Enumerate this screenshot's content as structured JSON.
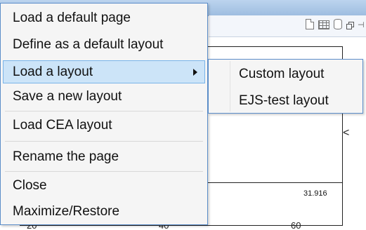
{
  "background": {
    "toolbar_icons": [
      "new-page-icon",
      "table-icon",
      "database-icon",
      "restore-window-icon",
      "pin-icon"
    ],
    "plot": {
      "value_label": "31.916",
      "x_ticks": [
        "20",
        "40",
        "60"
      ],
      "side_glyph": "<"
    }
  },
  "context_menu": {
    "items": [
      {
        "label": "Load a default page"
      },
      {
        "label": "Define as a default layout"
      },
      {
        "label": "Load a layout",
        "has_submenu": true,
        "highlighted": true
      },
      {
        "label": "Save a new layout"
      },
      {
        "label": "Load CEA layout"
      },
      {
        "label": "Rename the page"
      },
      {
        "label": "Close"
      },
      {
        "label": "Maximize/Restore"
      }
    ]
  },
  "submenu": {
    "items": [
      {
        "label": "Custom layout"
      },
      {
        "label": "EJS-test layout"
      }
    ]
  },
  "colors": {
    "menu_border": "#5b8dc9",
    "highlight_fill": "#cce4f8",
    "highlight_border": "#79b4e8"
  }
}
